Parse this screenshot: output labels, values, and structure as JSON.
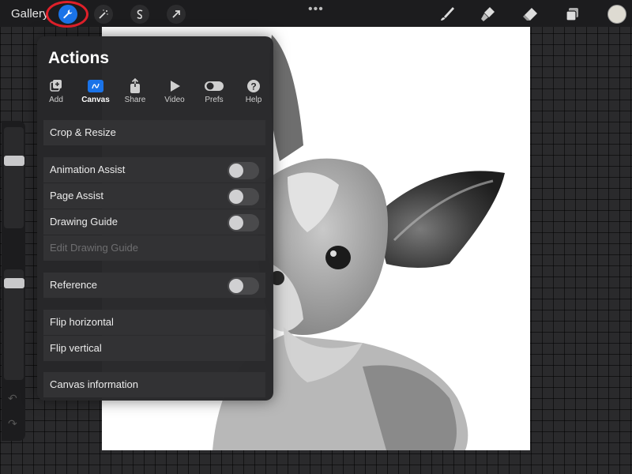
{
  "toolbar": {
    "gallery_label": "Gallery",
    "left_tools": [
      "wrench-icon",
      "magic-wand-icon",
      "selection-icon",
      "transform-arrow-icon"
    ],
    "right_tools": [
      "brush-icon",
      "smudge-icon",
      "eraser-icon",
      "layers-icon"
    ],
    "active_tool": "wrench-icon",
    "color_swatch": "#dedbd2",
    "highlight_color": "#e0202a"
  },
  "panel": {
    "title": "Actions",
    "tabs": [
      {
        "label": "Add",
        "icon": "add-icon"
      },
      {
        "label": "Canvas",
        "icon": "canvas-icon",
        "active": true
      },
      {
        "label": "Share",
        "icon": "share-icon"
      },
      {
        "label": "Video",
        "icon": "video-icon"
      },
      {
        "label": "Prefs",
        "icon": "prefs-icon"
      },
      {
        "label": "Help",
        "icon": "help-icon"
      }
    ],
    "items": [
      {
        "label": "Crop & Resize"
      },
      {
        "label": "Animation Assist",
        "toggle": false
      },
      {
        "label": "Page Assist",
        "toggle": false
      },
      {
        "label": "Drawing Guide",
        "toggle": false
      },
      {
        "label": "Edit Drawing Guide",
        "disabled": true
      },
      {
        "label": "Reference",
        "toggle": false
      },
      {
        "label": "Flip horizontal"
      },
      {
        "label": "Flip vertical"
      },
      {
        "label": "Canvas information"
      }
    ]
  },
  "colors": {
    "accent": "#1a73e8",
    "panel_bg": "#28282a",
    "row_bg": "#323234"
  }
}
